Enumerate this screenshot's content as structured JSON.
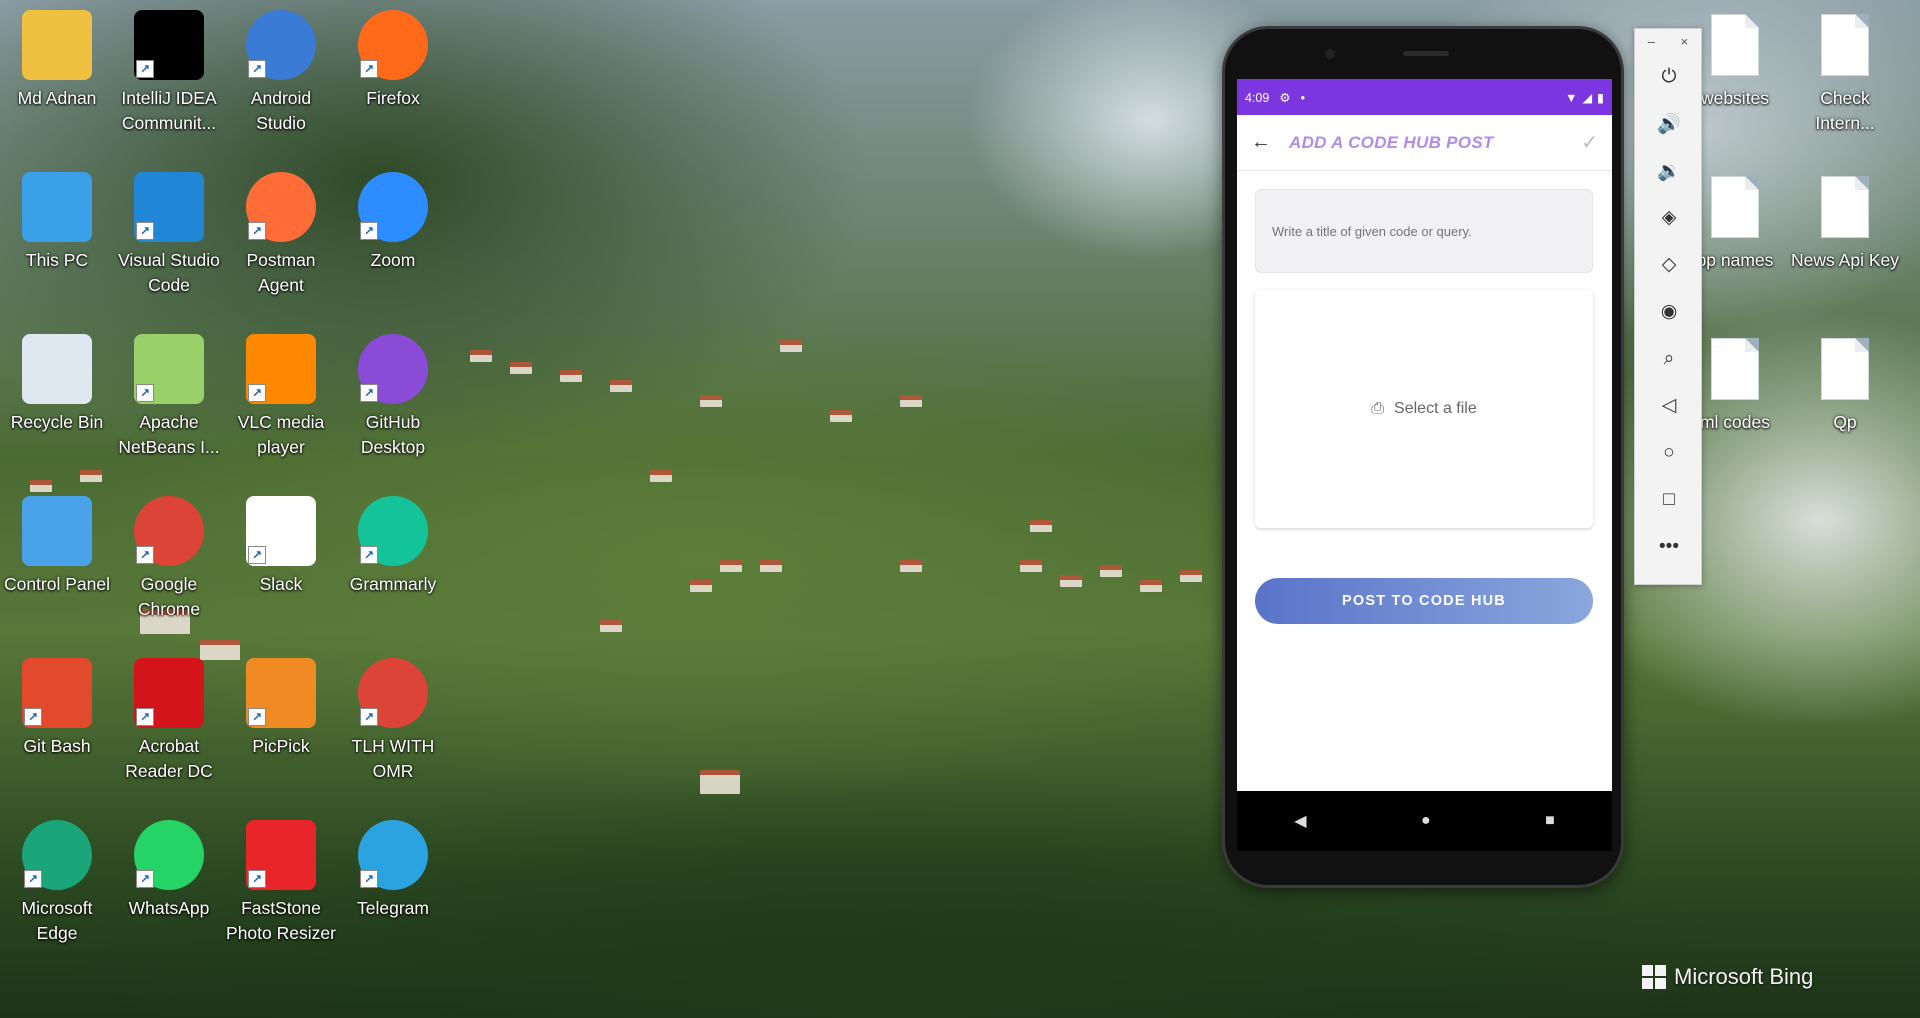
{
  "desktop": {
    "icons": [
      {
        "label": "Md Adnan",
        "icon": "user-folder-icon",
        "color": "#f0c040"
      },
      {
        "label": "IntelliJ IDEA Communit...",
        "icon": "intellij-icon",
        "color": "#000000"
      },
      {
        "label": "Android Studio",
        "icon": "android-studio-icon",
        "color": "#3a7bd5"
      },
      {
        "label": "Firefox",
        "icon": "firefox-icon",
        "color": "#ff6a1a"
      },
      {
        "label": "This PC",
        "icon": "computer-icon",
        "color": "#3aa0e8"
      },
      {
        "label": "Visual Studio Code",
        "icon": "vscode-icon",
        "color": "#1f87d6"
      },
      {
        "label": "Postman Agent",
        "icon": "postman-icon",
        "color": "#ff6c37"
      },
      {
        "label": "Zoom",
        "icon": "zoom-icon",
        "color": "#2d8cff"
      },
      {
        "label": "Recycle Bin",
        "icon": "recycle-bin-icon",
        "color": "#dfe8f0"
      },
      {
        "label": "Apache NetBeans I...",
        "icon": "netbeans-icon",
        "color": "#9ad06a"
      },
      {
        "label": "VLC media player",
        "icon": "vlc-icon",
        "color": "#ff8800"
      },
      {
        "label": "GitHub Desktop",
        "icon": "github-icon",
        "color": "#8a4bd6"
      },
      {
        "label": "Control Panel",
        "icon": "control-panel-icon",
        "color": "#4aa3e8"
      },
      {
        "label": "Google Chrome",
        "icon": "chrome-icon",
        "color": "#db4437"
      },
      {
        "label": "Slack",
        "icon": "slack-icon",
        "color": "#ffffff"
      },
      {
        "label": "Grammarly",
        "icon": "grammarly-icon",
        "color": "#15c39a"
      },
      {
        "label": "Git Bash",
        "icon": "git-bash-icon",
        "color": "#e24a2d"
      },
      {
        "label": "Acrobat Reader DC",
        "icon": "acrobat-icon",
        "color": "#d4141b"
      },
      {
        "label": "PicPick",
        "icon": "picpick-icon",
        "color": "#f08a24"
      },
      {
        "label": "TLH WITH OMR",
        "icon": "chrome-icon",
        "color": "#db4437"
      },
      {
        "label": "Microsoft Edge",
        "icon": "edge-icon",
        "color": "#1aa57a"
      },
      {
        "label": "WhatsApp",
        "icon": "whatsapp-icon",
        "color": "#25d366"
      },
      {
        "label": "FastStone Photo Resizer",
        "icon": "faststone-icon",
        "color": "#e8262a"
      },
      {
        "label": "Telegram",
        "icon": "telegram-icon",
        "color": "#2aa3e0"
      }
    ],
    "right_icons": [
      {
        "label": "websites"
      },
      {
        "label": "Check Intern..."
      },
      {
        "label": "pp names"
      },
      {
        "label": "News Api Key"
      },
      {
        "label": "ml codes"
      },
      {
        "label": "Qp"
      }
    ]
  },
  "phone": {
    "status": {
      "time": "4:09",
      "settings_icon": "gear-icon",
      "dot": "•"
    },
    "toolbar": {
      "title": "ADD A CODE HUB POST",
      "back_icon": "arrow-left-icon",
      "check_icon": "check-icon"
    },
    "form": {
      "title_placeholder": "Write a title of given code or query.",
      "file_label": "Select a file",
      "post_button": "POST TO CODE HUB"
    },
    "colors": {
      "accent": "#7b36e0",
      "title": "#b18be8",
      "button_start": "#5a73c9",
      "button_end": "#8aa7dd"
    }
  },
  "emulator_toolbar": {
    "window_controls": [
      "–",
      "×"
    ],
    "buttons": [
      {
        "name": "power-icon",
        "glyph": "⏻"
      },
      {
        "name": "volume-up-icon",
        "glyph": "🔊"
      },
      {
        "name": "volume-down-icon",
        "glyph": "🔉"
      },
      {
        "name": "rotate-left-icon",
        "glyph": "◈"
      },
      {
        "name": "rotate-right-icon",
        "glyph": "◇"
      },
      {
        "name": "camera-icon",
        "glyph": "◉"
      },
      {
        "name": "zoom-icon",
        "glyph": "⌕"
      },
      {
        "name": "back-icon",
        "glyph": "◁"
      },
      {
        "name": "home-icon",
        "glyph": "○"
      },
      {
        "name": "overview-icon",
        "glyph": "□"
      },
      {
        "name": "more-icon",
        "glyph": "•••"
      }
    ]
  },
  "watermark": {
    "text": "Microsoft Bing"
  }
}
